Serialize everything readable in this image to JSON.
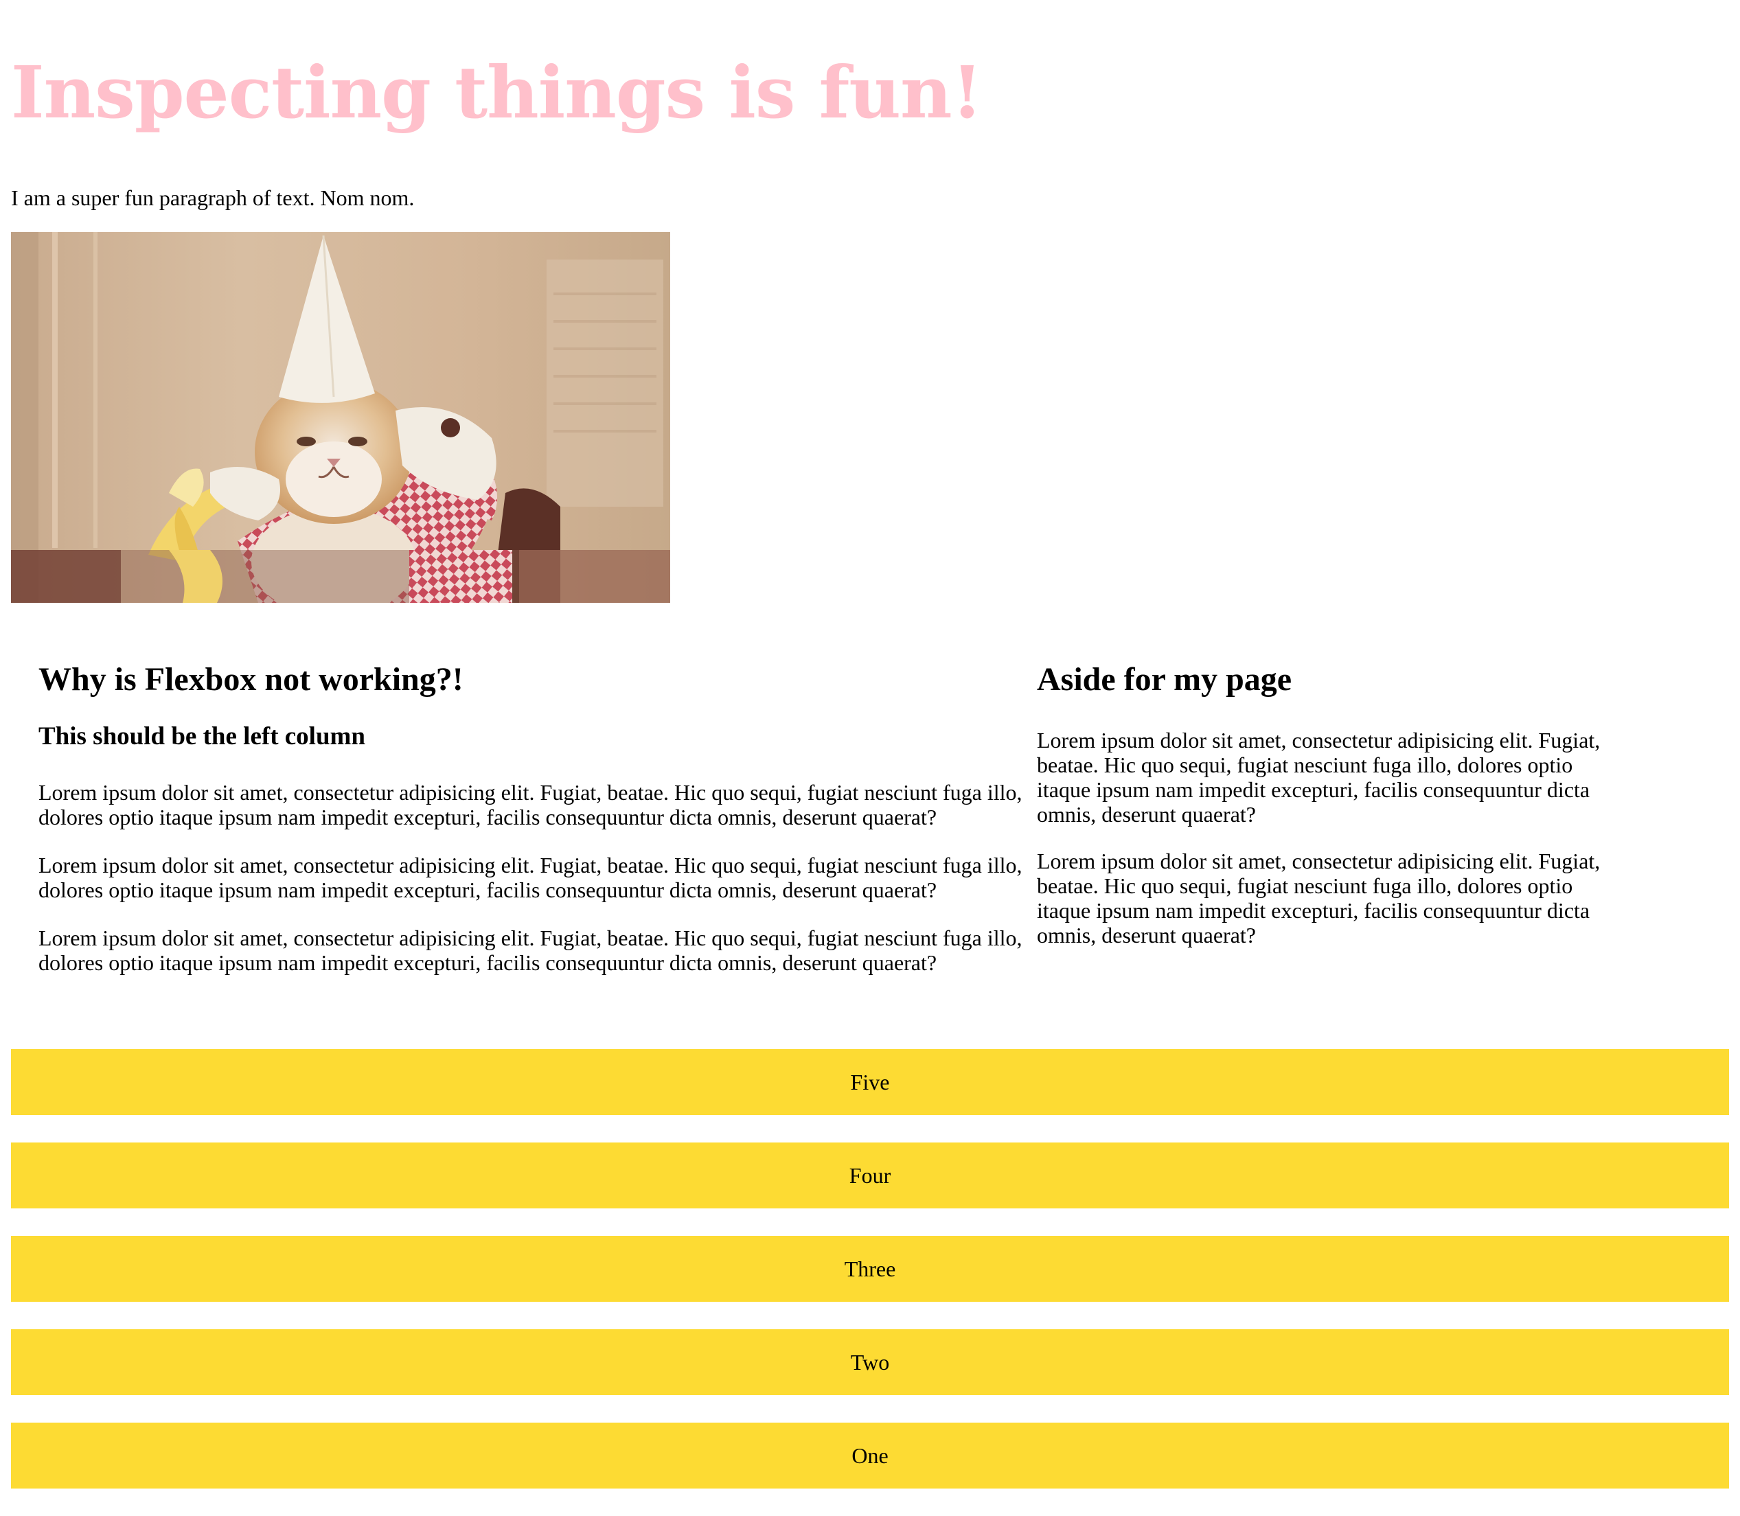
{
  "hero": {
    "title": "Inspecting things is fun!",
    "title_color": "#ffc0cb"
  },
  "intro": {
    "text": "I am a super fun paragraph of text. Nom nom."
  },
  "gif": {
    "subject": "cat wearing a paper hat eating a banana"
  },
  "main": {
    "heading": "Why is Flexbox not working?!",
    "subheading": "This should be the left column",
    "paragraphs": [
      "Lorem ipsum dolor sit amet, consectetur adipisicing elit. Fugiat, beatae. Hic quo sequi, fugiat nesciunt fuga illo, dolores optio itaque ipsum nam impedit excepturi, facilis consequuntur dicta omnis, deserunt quaerat?",
      "Lorem ipsum dolor sit amet, consectetur adipisicing elit. Fugiat, beatae. Hic quo sequi, fugiat nesciunt fuga illo, dolores optio itaque ipsum nam impedit excepturi, facilis consequuntur dicta omnis, deserunt quaerat?",
      "Lorem ipsum dolor sit amet, consectetur adipisicing elit. Fugiat, beatae. Hic quo sequi, fugiat nesciunt fuga illo, dolores optio itaque ipsum nam impedit excepturi, facilis consequuntur dicta omnis, deserunt quaerat?"
    ]
  },
  "aside": {
    "heading": "Aside for my page",
    "paragraphs": [
      "Lorem ipsum dolor sit amet, consectetur adipisicing elit. Fugiat, beatae. Hic quo sequi, fugiat nesciunt fuga illo, dolores optio itaque ipsum nam impedit excepturi, facilis consequuntur dicta omnis, deserunt quaerat?",
      "Lorem ipsum dolor sit amet, consectetur adipisicing elit. Fugiat, beatae. Hic quo sequi, fugiat nesciunt fuga illo, dolores optio itaque ipsum nam impedit excepturi, facilis consequuntur dicta omnis, deserunt quaerat?"
    ]
  },
  "stack": {
    "items": [
      "Five",
      "Four",
      "Three",
      "Two",
      "One"
    ],
    "item_color": "#fddb33"
  }
}
